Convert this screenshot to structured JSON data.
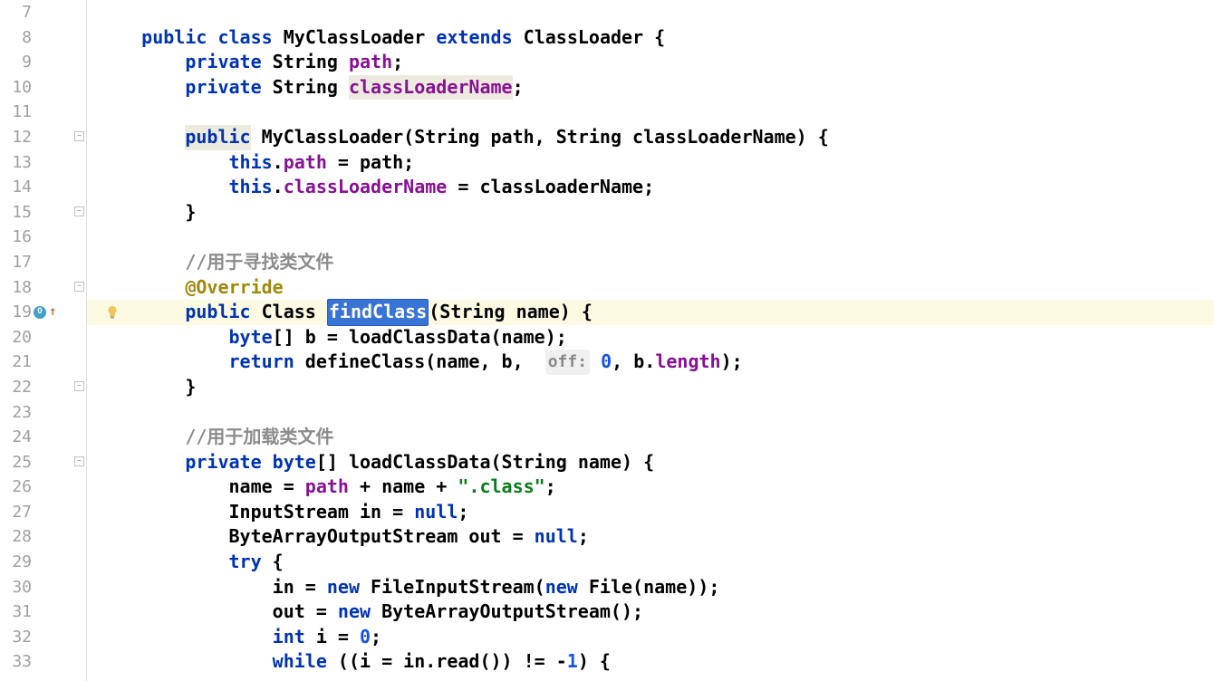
{
  "gutter": {
    "start": 7,
    "end": 33
  },
  "icons": {
    "override_line": 19,
    "bulb_line": 19,
    "fold_open_lines": [
      12,
      15,
      18,
      22,
      25
    ],
    "fold_close_lines": []
  },
  "code": {
    "l7": "",
    "l8": {
      "ind": "    ",
      "t": [
        {
          "c": "hl-keyword",
          "v": "public"
        },
        {
          "v": " "
        },
        {
          "c": "hl-keyword",
          "v": "class"
        },
        {
          "v": " "
        },
        {
          "c": "hl-type",
          "v": "MyClassLoader"
        },
        {
          "v": " "
        },
        {
          "c": "hl-keyword",
          "v": "extends"
        },
        {
          "v": " "
        },
        {
          "c": "hl-type",
          "v": "ClassLoader"
        },
        {
          "v": " {"
        }
      ]
    },
    "l9": {
      "ind": "        ",
      "t": [
        {
          "c": "hl-keyword",
          "v": "private"
        },
        {
          "v": " "
        },
        {
          "c": "hl-type",
          "v": "String"
        },
        {
          "v": " "
        },
        {
          "c": "hl-field",
          "v": "path"
        },
        {
          "v": ";"
        }
      ]
    },
    "l10": {
      "ind": "        ",
      "t": [
        {
          "c": "hl-keyword",
          "v": "private"
        },
        {
          "v": " "
        },
        {
          "c": "hl-type",
          "v": "String"
        },
        {
          "v": " "
        },
        {
          "c": "hl-field-hl",
          "v": "classLoaderName"
        },
        {
          "v": ";"
        }
      ]
    },
    "l11": "",
    "l12": {
      "ind": "        ",
      "t": [
        {
          "c": "hl-keyword-hl",
          "v": "public"
        },
        {
          "v": " "
        },
        {
          "c": "hl-type",
          "v": "MyClassLoader"
        },
        {
          "v": "(String path, String classLoaderName) {"
        }
      ]
    },
    "l13": {
      "ind": "            ",
      "t": [
        {
          "c": "hl-keyword",
          "v": "this"
        },
        {
          "v": "."
        },
        {
          "c": "hl-field",
          "v": "path"
        },
        {
          "v": " = path;"
        }
      ]
    },
    "l14": {
      "ind": "            ",
      "t": [
        {
          "c": "hl-keyword",
          "v": "this"
        },
        {
          "v": "."
        },
        {
          "c": "hl-field",
          "v": "classLoaderName"
        },
        {
          "v": " = classLoaderName;"
        }
      ]
    },
    "l15": {
      "ind": "        ",
      "t": [
        {
          "v": "}"
        }
      ]
    },
    "l16": "",
    "l17": {
      "ind": "        ",
      "t": [
        {
          "c": "hl-comment",
          "v": "//用于寻找类文件"
        }
      ]
    },
    "l18": {
      "ind": "        ",
      "t": [
        {
          "c": "hl-anno",
          "v": "@Override"
        }
      ]
    },
    "l19": {
      "ind": "        ",
      "hl": true,
      "t": [
        {
          "c": "hl-keyword",
          "v": "public"
        },
        {
          "v": " "
        },
        {
          "c": "hl-type",
          "v": "Class"
        },
        {
          "v": " "
        },
        {
          "c": "hl-selected",
          "v": "findClass"
        },
        {
          "v": "(String name) {"
        }
      ]
    },
    "l20": {
      "ind": "            ",
      "t": [
        {
          "c": "hl-keyword",
          "v": "byte"
        },
        {
          "v": "[] b = loadClassData(name);"
        }
      ]
    },
    "l21": {
      "ind": "            ",
      "t": [
        {
          "c": "hl-keyword",
          "v": "return"
        },
        {
          "v": " defineClass(name, b,  "
        },
        {
          "c": "hl-paramhint",
          "v": "off:"
        },
        {
          "v": " "
        },
        {
          "c": "hl-num",
          "v": "0"
        },
        {
          "v": ", b."
        },
        {
          "c": "hl-field",
          "v": "length"
        },
        {
          "v": ");"
        }
      ]
    },
    "l22": {
      "ind": "        ",
      "t": [
        {
          "v": "}"
        }
      ]
    },
    "l23": "",
    "l24": {
      "ind": "        ",
      "t": [
        {
          "c": "hl-comment",
          "v": "//用于加载类文件"
        }
      ]
    },
    "l25": {
      "ind": "        ",
      "t": [
        {
          "c": "hl-keyword",
          "v": "private"
        },
        {
          "v": " "
        },
        {
          "c": "hl-keyword",
          "v": "byte"
        },
        {
          "v": "[] loadClassData(String name) {"
        }
      ]
    },
    "l26": {
      "ind": "            ",
      "t": [
        {
          "v": "name = "
        },
        {
          "c": "hl-field",
          "v": "path"
        },
        {
          "v": " + name + "
        },
        {
          "c": "hl-string",
          "v": "\".class\""
        },
        {
          "v": ";"
        }
      ]
    },
    "l27": {
      "ind": "            ",
      "t": [
        {
          "v": "InputStream in = "
        },
        {
          "c": "hl-keyword",
          "v": "null"
        },
        {
          "v": ";"
        }
      ]
    },
    "l28": {
      "ind": "            ",
      "t": [
        {
          "v": "ByteArrayOutputStream out = "
        },
        {
          "c": "hl-keyword",
          "v": "null"
        },
        {
          "v": ";"
        }
      ]
    },
    "l29": {
      "ind": "            ",
      "t": [
        {
          "c": "hl-keyword",
          "v": "try"
        },
        {
          "v": " {"
        }
      ]
    },
    "l30": {
      "ind": "                ",
      "t": [
        {
          "v": "in = "
        },
        {
          "c": "hl-keyword",
          "v": "new"
        },
        {
          "v": " FileInputStream("
        },
        {
          "c": "hl-keyword",
          "v": "new"
        },
        {
          "v": " File(name));"
        }
      ]
    },
    "l31": {
      "ind": "                ",
      "t": [
        {
          "v": "out = "
        },
        {
          "c": "hl-keyword",
          "v": "new"
        },
        {
          "v": " ByteArrayOutputStream();"
        }
      ]
    },
    "l32": {
      "ind": "                ",
      "t": [
        {
          "c": "hl-keyword",
          "v": "int"
        },
        {
          "v": " i = "
        },
        {
          "c": "hl-num",
          "v": "0"
        },
        {
          "v": ";"
        }
      ]
    },
    "l33": {
      "ind": "                ",
      "t": [
        {
          "c": "hl-keyword",
          "v": "while"
        },
        {
          "v": " ((i = in.read()) != -"
        },
        {
          "c": "hl-num",
          "v": "1"
        },
        {
          "v": ") {"
        }
      ]
    }
  }
}
